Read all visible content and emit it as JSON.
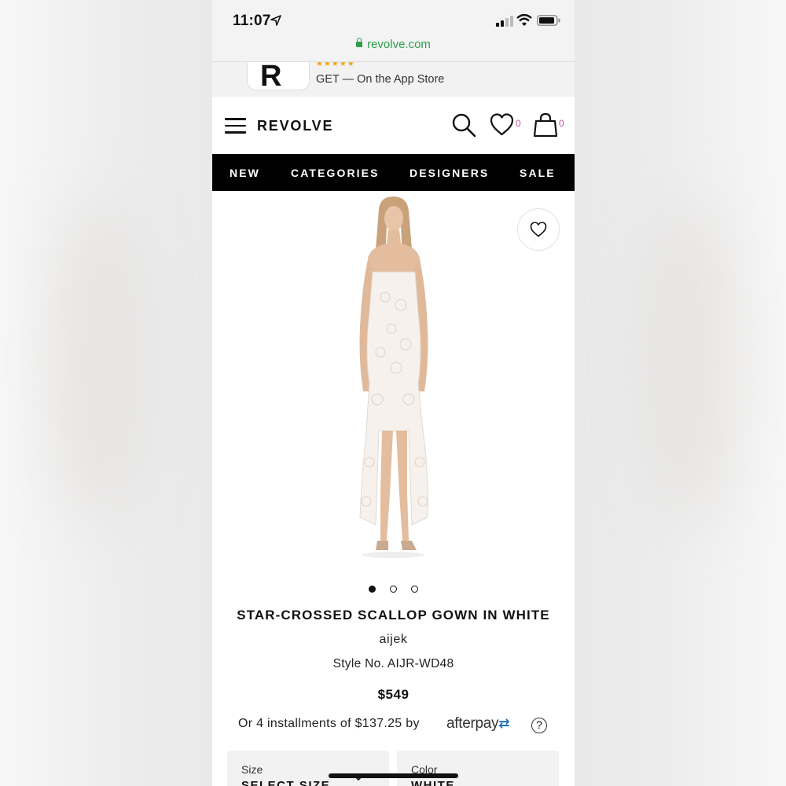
{
  "status_bar": {
    "time": "11:07",
    "url": "revolve.com"
  },
  "app_banner": {
    "stars": "★★★★★",
    "cta": "GET — On the App Store",
    "icon_letter": "R"
  },
  "header": {
    "logo": "REVOLVE",
    "wishlist_count": "0",
    "cart_count": "0"
  },
  "nav": {
    "tabs": [
      "NEW",
      "CATEGORIES",
      "DESIGNERS",
      "SALE"
    ]
  },
  "gallery": {
    "image_count": 3,
    "active_index": 0
  },
  "product": {
    "title": "STAR-CROSSED SCALLOP GOWN IN WHITE",
    "brand": "aijek",
    "style_no": "Style No. AIJR-WD48",
    "price": "$549",
    "installments": "Or 4 installments of $137.25 by",
    "afterpay_word": "afterpay",
    "help": "?"
  },
  "selectors": {
    "size": {
      "label": "Size",
      "value": "SELECT SIZE"
    },
    "color": {
      "label": "Color",
      "value": "WHITE"
    }
  },
  "colors": {
    "accent_count": "#c2569e",
    "url_green": "#2e9e4d",
    "nav_bg": "#000000"
  }
}
